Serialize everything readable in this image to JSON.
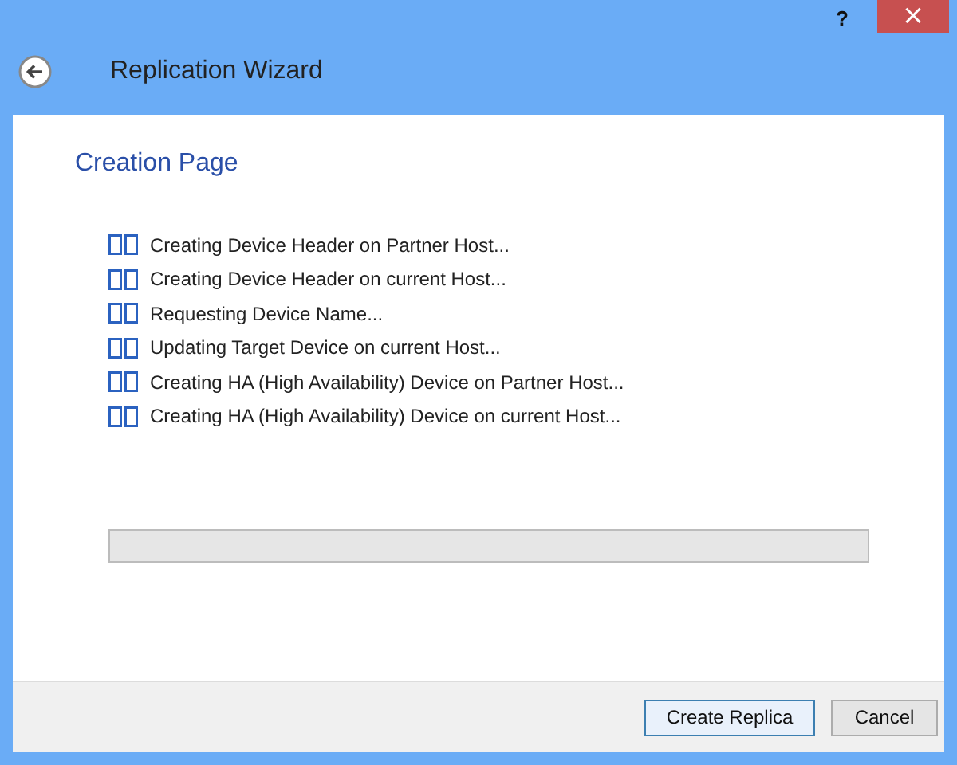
{
  "window": {
    "help": "?",
    "close": "×",
    "title": "Replication Wizard"
  },
  "page": {
    "heading": "Creation Page"
  },
  "steps": [
    {
      "label": "Creating Device Header on Partner Host..."
    },
    {
      "label": "Creating Device Header on current Host..."
    },
    {
      "label": "Requesting Device Name..."
    },
    {
      "label": "Updating Target Device on current Host..."
    },
    {
      "label": "Creating HA (High Availability) Device on Partner Host..."
    },
    {
      "label": "Creating HA (High Availability) Device on current Host..."
    }
  ],
  "progress": {
    "level": 0
  },
  "buttons": [
    {
      "label": "Create Replica",
      "focused": true
    },
    {
      "label": "Cancel",
      "focused": false
    }
  ]
}
